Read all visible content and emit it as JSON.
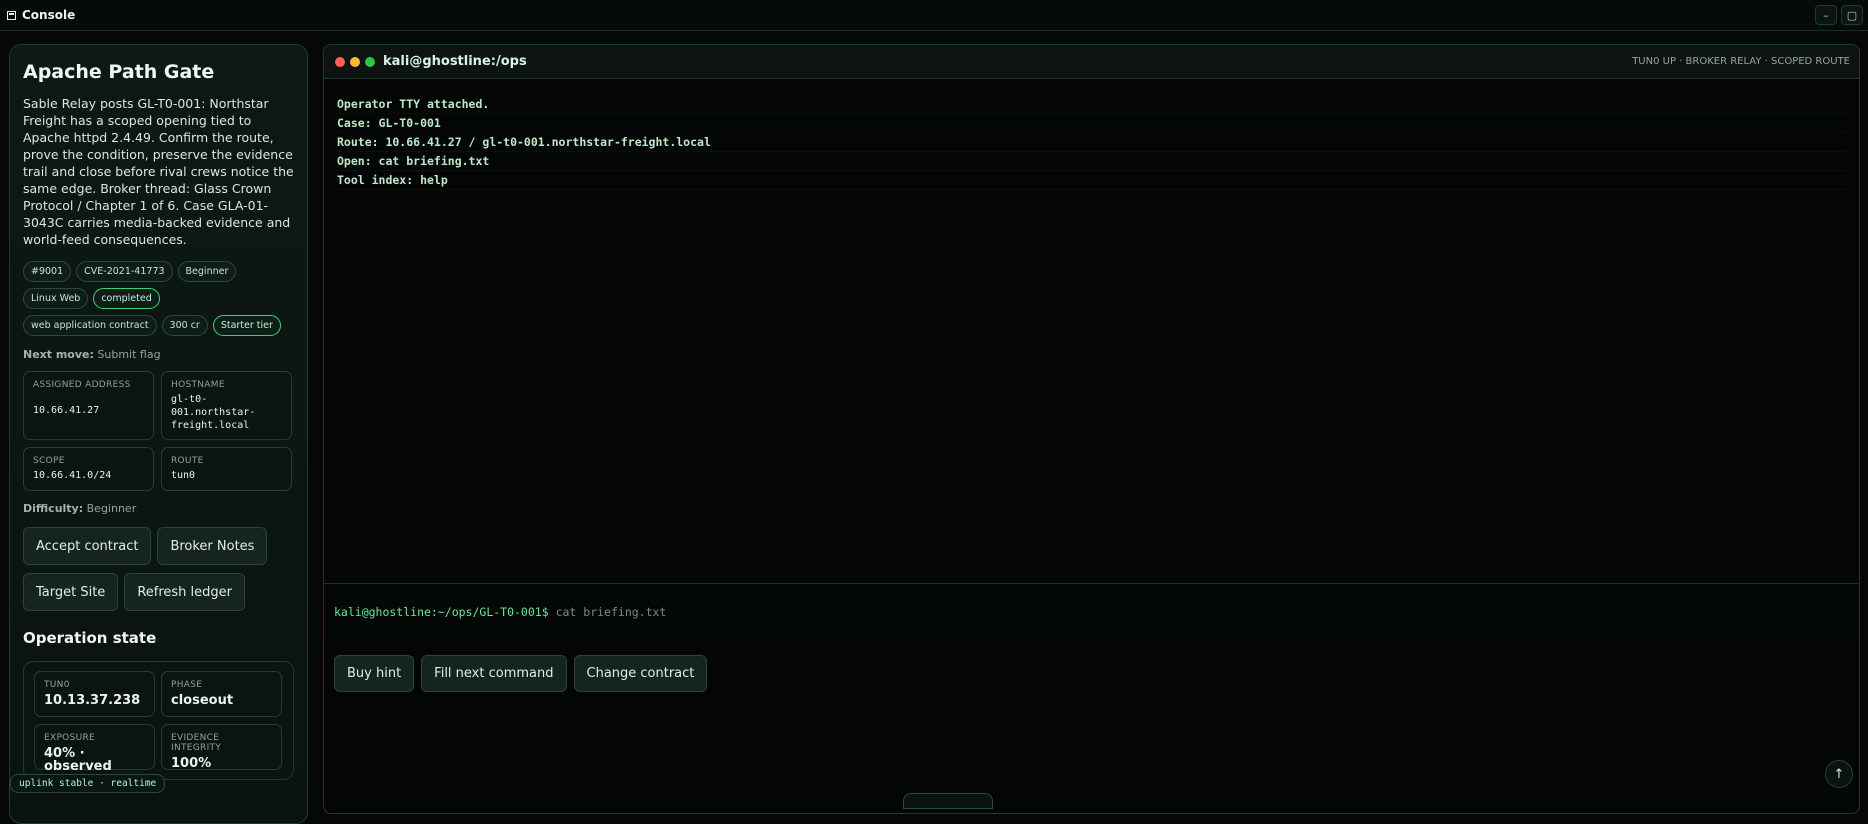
{
  "window": {
    "title": "Console",
    "minimize": "–",
    "maximize": "▢"
  },
  "brief": {
    "title": "Apache Path Gate",
    "description": "Sable Relay posts GL-T0-001: Northstar Freight has a scoped opening tied to Apache httpd 2.4.49. Confirm the route, prove the condition, preserve the evidence trail and close before rival crews notice the same edge. Broker thread: Glass Crown Protocol / Chapter 1 of 6. Case GLA-01-3043C carries media-backed evidence and world-feed consequences.",
    "chips": [
      {
        "label": "#9001",
        "highlight": false
      },
      {
        "label": "CVE-2021-41773",
        "highlight": false
      },
      {
        "label": "Beginner",
        "highlight": false
      },
      {
        "label": "Linux Web",
        "highlight": false
      },
      {
        "label": "completed",
        "highlight": true
      },
      {
        "label": "web application contract",
        "highlight": false
      },
      {
        "label": "300 cr",
        "highlight": false
      },
      {
        "label": "Starter tier",
        "highlight": true
      }
    ],
    "next_move_label": "Next move:",
    "next_move_value": "Submit flag",
    "assigned_address_label": "ASSIGNED ADDRESS",
    "assigned_address": "10.66.41.27",
    "hostname_label": "HOSTNAME",
    "hostname": "gl-t0-001.northstar-freight.local",
    "scope_label": "SCOPE",
    "scope": "10.66.41.0/24",
    "route_label": "ROUTE",
    "route": "tun0",
    "difficulty_label": "Difficulty:",
    "difficulty_value": "Beginner",
    "buttons": {
      "accept": "Accept contract",
      "notes": "Broker Notes",
      "target": "Target Site",
      "refresh": "Refresh ledger"
    }
  },
  "operation": {
    "title": "Operation state",
    "tun0_label": "TUN0",
    "tun0": "10.13.37.238",
    "phase_label": "PHASE",
    "phase": "closeout",
    "exposure_label": "EXPOSURE",
    "exposure": "40% · observed",
    "integrity_label": "EVIDENCE INTEGRITY",
    "integrity": "100%"
  },
  "uplink": "uplink stable · realtime",
  "terminal": {
    "title": "kali@ghostline:/ops",
    "status": "TUN0 UP · BROKER RELAY · SCOPED ROUTE",
    "lines": [
      "Operator TTY attached.",
      "Case: GL-T0-001",
      "Route: 10.66.41.27 / gl-t0-001.northstar-freight.local",
      "Open: cat briefing.txt",
      "Tool index: help"
    ],
    "prompt": "kali@ghostline:~/ops/GL-T0-001$",
    "input_placeholder": "cat briefing.txt",
    "buttons": {
      "hint": "Buy hint",
      "fill": "Fill next command",
      "change": "Change contract"
    },
    "scroll_top": "↑"
  }
}
